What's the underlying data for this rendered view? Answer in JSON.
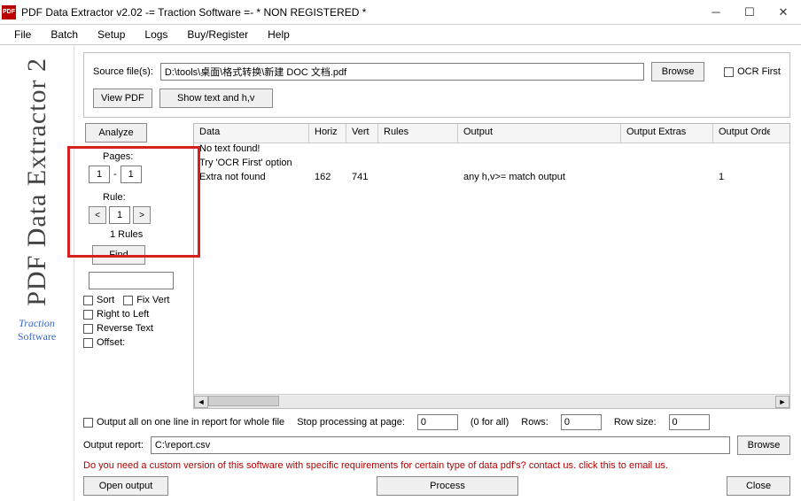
{
  "window": {
    "title": "PDF Data Extractor v2.02   -= Traction Software =- * NON REGISTERED *"
  },
  "menu": {
    "file": "File",
    "batch": "Batch",
    "setup": "Setup",
    "logs": "Logs",
    "buy": "Buy/Register",
    "help": "Help"
  },
  "source": {
    "label": "Source file(s):",
    "path": "D:\\tools\\桌面\\格式转换\\新建 DOC 文档.pdf",
    "browse": "Browse",
    "ocr_first": "OCR First",
    "view_pdf": "View PDF",
    "show_text": "Show text and h,v"
  },
  "left": {
    "analyze": "Analyze",
    "pages_label": "Pages:",
    "page_from": "1",
    "page_to": "1",
    "rule_label": "Rule:",
    "rule_num": "1",
    "rules_count": "1  Rules",
    "find": "Find",
    "sort": "Sort",
    "fixvert": "Fix Vert",
    "rtl": "Right to Left",
    "reverse": "Reverse Text",
    "offset": "Offset:"
  },
  "table": {
    "headers": {
      "data": "Data",
      "horiz": "Horiz",
      "vert": "Vert",
      "rules": "Rules",
      "output": "Output",
      "extras": "Output Extras",
      "order": "Output Order"
    },
    "rows": [
      {
        "data": "No text found!",
        "horiz": "",
        "vert": "",
        "rules": "",
        "output": "",
        "extras": "",
        "order": ""
      },
      {
        "data": "Try 'OCR First' option",
        "horiz": "",
        "vert": "",
        "rules": "",
        "output": "",
        "extras": "",
        "order": ""
      },
      {
        "data": "Extra not found",
        "horiz": "162",
        "vert": "741",
        "rules": "",
        "output": "any h,v>= match output",
        "extras": "",
        "order": "1"
      }
    ]
  },
  "bottom": {
    "output_all": "Output all on one line in report for whole file",
    "stop_label": "Stop processing at page:",
    "stop_val": "0",
    "stop_hint": "(0 for all)",
    "rows_label": "Rows:",
    "rows_val": "0",
    "rowsize_label": "Row size:",
    "rowsize_val": "0",
    "report_label": "Output report:",
    "report_path": "C:\\report.csv",
    "browse": "Browse",
    "promo": "Do you need a custom version of this software with specific requirements for certain type of data pdf's? contact us. click this to email us.",
    "open": "Open output",
    "process": "Process",
    "close": "Close"
  },
  "sidebar": {
    "brand": "PDF Data Extractor 2",
    "company_t": "Traction",
    "company_s": "Software"
  }
}
